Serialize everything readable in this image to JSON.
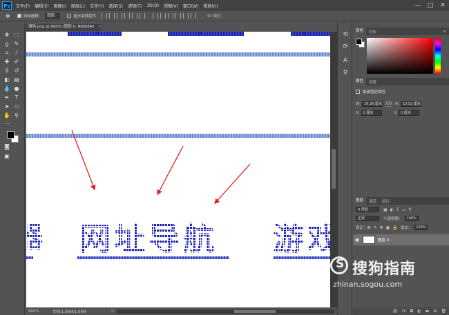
{
  "app": {
    "logo": "Ps"
  },
  "menu": [
    "文件(F)",
    "编辑(E)",
    "图像(I)",
    "图层(L)",
    "文字(Y)",
    "选择(S)",
    "滤镜(T)",
    "3D(D)",
    "视图(V)",
    "窗口(W)",
    "帮助(H)"
  ],
  "window_controls": {
    "minimize": "—",
    "maximize": "□",
    "close": "✕"
  },
  "options_bar": {
    "auto_select_label": "自动选择：",
    "auto_select_value": "图层",
    "show_transform_label": "显示变换控件",
    "mode_3d": "3D 模式："
  },
  "document": {
    "tab_title": "搜狗.png @ 800% (图层 0, RGB/8#)",
    "tab_close": "×",
    "headline_left": "器",
    "headline_main": "网址导航",
    "headline_right": "游戏",
    "zoom": "800%",
    "doc_size": "文档:1.06M/1.06M",
    "status_arrow": ">"
  },
  "panels": {
    "color": {
      "tabs": [
        "颜色",
        "色板"
      ],
      "menu": "≡",
      "foreground": "#000000",
      "background": "#ffffff"
    },
    "properties": {
      "tabs": [
        "属性",
        "调整"
      ],
      "title": "像素图层属性",
      "w_label": "W:",
      "w_value": "19.26 厘米",
      "link": "GO",
      "h_label": "H:",
      "h_value": "13.52 厘米",
      "x_label": "X:",
      "x_value": "0 厘米",
      "y_label": "Y:",
      "y_value": "0 厘米"
    },
    "layers": {
      "tabs": [
        "图层",
        "通道",
        "路径"
      ],
      "kind_filter": "ρ 类型",
      "blend_mode": "正常",
      "opacity_label": "不透明度：",
      "opacity_value": "100%",
      "lock_label": "锁定：",
      "fill_label": "填充：",
      "fill_value": "100%",
      "layer_name": "图层 0"
    }
  },
  "watermark": {
    "name": "搜狗指南",
    "url": "zhinan.sogou.com"
  },
  "colors": {
    "pixel_text": "#1c20b8",
    "arrow": "#e02020",
    "guide_band": "#9db4e6"
  }
}
